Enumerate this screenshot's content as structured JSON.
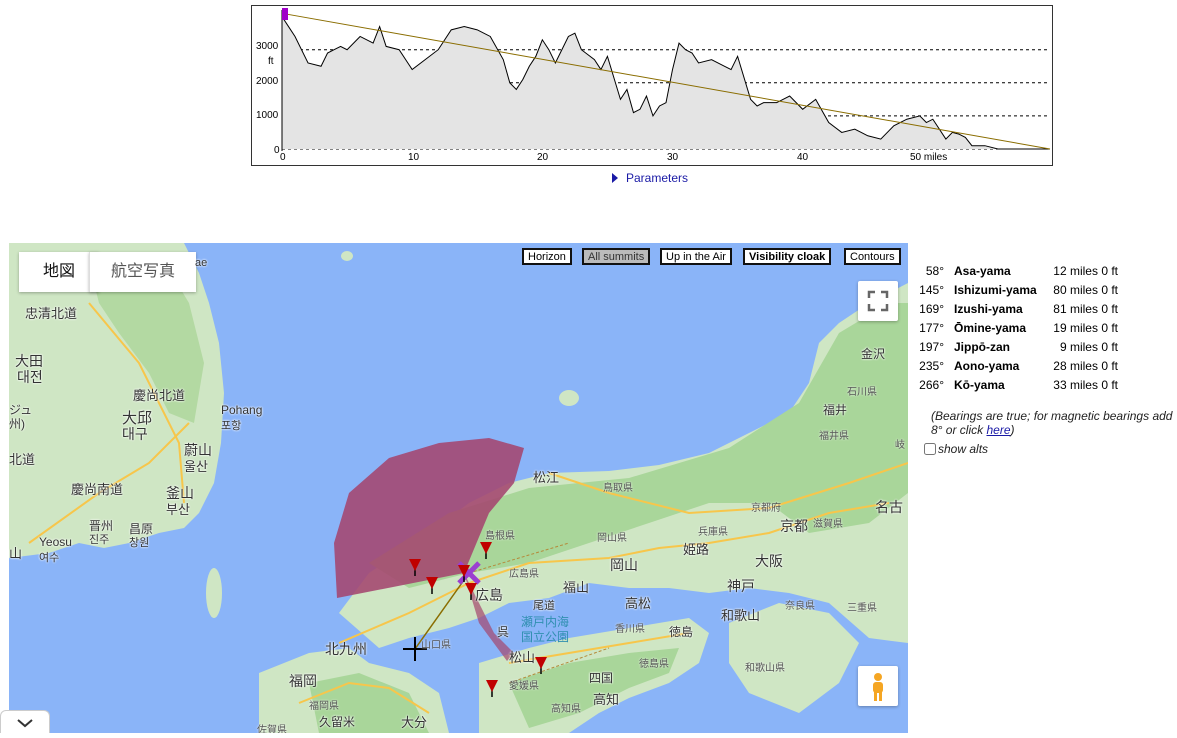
{
  "profile": {
    "y_unit": "ft",
    "y_ticks": [
      "3000",
      "2000",
      "1000",
      "0"
    ],
    "x_ticks": [
      "0",
      "10",
      "20",
      "30",
      "40",
      "50 miles"
    ],
    "colors": {
      "terrain_fill": "#e4e4e4",
      "terrain_line": "#000000",
      "sightline": "#8a6d00",
      "start_marker": "#a000c8"
    }
  },
  "chart_data": {
    "type": "area",
    "title": "",
    "xlabel": "miles",
    "ylabel": "ft",
    "xlim": [
      0,
      59
    ],
    "ylim": [
      0,
      4200
    ],
    "grid": true,
    "series": [
      {
        "values_x": [
          0,
          0.5,
          1,
          2,
          3,
          3.5,
          4,
          4.5,
          5,
          6,
          7,
          7.5,
          8,
          9,
          9.5,
          10,
          11,
          12,
          13,
          14,
          15,
          16,
          17,
          17.5,
          18,
          18.5,
          19,
          19.5,
          20,
          20.5,
          21,
          22,
          22.5,
          23,
          24,
          24.5,
          25,
          26,
          26.5,
          27,
          27.5,
          28,
          28.5,
          29,
          29.5,
          30,
          30.5,
          31,
          31.5,
          32,
          33,
          34,
          34.5,
          35,
          36,
          36.5,
          37,
          38,
          39,
          40,
          41,
          42,
          43,
          44,
          44.5,
          45,
          46,
          47,
          48,
          49,
          49.5,
          50,
          51,
          51.5,
          52,
          52.5,
          53,
          54,
          55,
          56,
          57,
          58,
          59
        ],
        "values_y": [
          4000,
          3700,
          3400,
          2600,
          2500,
          2900,
          3000,
          3100,
          3000,
          3400,
          3200,
          3700,
          3100,
          3000,
          2700,
          2400,
          2700,
          3000,
          3600,
          3700,
          3600,
          3400,
          2700,
          2000,
          1800,
          2100,
          2500,
          2800,
          3300,
          3000,
          2600,
          3400,
          3500,
          3000,
          2700,
          2400,
          2800,
          1500,
          1800,
          1100,
          1200,
          1600,
          1000,
          1300,
          1400,
          2400,
          3200,
          3000,
          2900,
          2600,
          2700,
          2500,
          2400,
          2800,
          1500,
          1300,
          1400,
          1400,
          1600,
          1200,
          1500,
          800,
          500,
          600,
          500,
          400,
          300,
          700,
          900,
          1000,
          800,
          900,
          300,
          500,
          450,
          350,
          100,
          100,
          0,
          0,
          0,
          0,
          0
        ]
      },
      {
        "name": "",
        "values_x": [
          0,
          59
        ],
        "values_y": [
          4100,
          0
        ]
      }
    ]
  },
  "parameters_label": "Parameters",
  "map": {
    "tabs": [
      "地図",
      "航空写真"
    ],
    "toolbar": [
      "Horizon",
      "All summits",
      "Up in the Air",
      "Visibility cloak",
      "Contours"
    ],
    "labels": {
      "chungbuk": "忠清北道",
      "daejeon1": "大田",
      "daejeon2": "대전",
      "gyeongbuk": "慶尚北道",
      "pohang1": "Pohang",
      "pohang2": "포항",
      "daegu1": "大邱",
      "daegu2": "대구",
      "ulsan1": "蔚山",
      "ulsan2": "울산",
      "gyeongnam": "慶尚南道",
      "busan1": "釜山",
      "busan2": "부산",
      "jinju1": "晋州",
      "jinju2": "진주",
      "changwon1": "昌原",
      "changwon2": "창원",
      "yeosu1": "Yeosu",
      "yeosu2": "여수",
      "jeolla": "北道",
      "jeolla2": "ジュ",
      "jeolla3": "州)",
      "jeolla4": "山",
      "top_ae": "ae",
      "matsue": "松江",
      "tottori": "鳥取県",
      "shimane": "島根県",
      "okayama_pref": "岡山県",
      "hyogo": "兵庫県",
      "kyoto_pref": "京都府",
      "shiga": "滋賀県",
      "fukui": "福井県",
      "fukui_city": "福井",
      "ishikawa": "石川県",
      "kanazawa": "金沢",
      "gifu": "岐",
      "nagoya": "名古",
      "kyoto": "京都",
      "okayama": "岡山",
      "himeji": "姫路",
      "osaka": "大阪",
      "kobe": "神戸",
      "fukuyama": "福山",
      "hiroshima_pref": "広島県",
      "hiroshima": "広島",
      "onomichi": "尾道",
      "takamatsu": "高松",
      "kagawa": "香川県",
      "tokushima": "徳島",
      "tokushima_pref": "徳島県",
      "wakayama": "和歌山",
      "wakayama_pref": "和歌山県",
      "nara": "奈良県",
      "mie": "三重県",
      "kure": "呉",
      "inland_sea1": "瀬戸内海",
      "inland_sea2": "国立公園",
      "yamaguchi_pref": "山口県",
      "kitakyushu": "北九州",
      "fukuoka": "福岡",
      "fukuoka_pref": "福岡県",
      "kurume": "久留米",
      "saga": "佐賀県",
      "oita": "大分",
      "matsuyama": "松山",
      "ehime": "愛媛県",
      "shikoku": "四国",
      "kochi": "高知",
      "kochi_pref": "高知県"
    },
    "colors": {
      "sea": "#8ab4f8",
      "land": "#cfe6c4",
      "land_green": "#a9d69a",
      "road": "#f7c64b",
      "cloak": "#a4466e",
      "marker": "#c00000",
      "origin_x": "#9b3fd0"
    }
  },
  "summits": [
    {
      "bearing": "58°",
      "name": "Asa-yama",
      "distance": "12 miles 0 ft"
    },
    {
      "bearing": "145°",
      "name": "Ishizumi-yama",
      "distance": "80 miles 0 ft"
    },
    {
      "bearing": "169°",
      "name": "Izushi-yama",
      "distance": "81 miles 0 ft"
    },
    {
      "bearing": "177°",
      "name": "Ōmine-yama",
      "distance": "19 miles 0 ft"
    },
    {
      "bearing": "197°",
      "name": "Jippō-zan",
      "distance": "9 miles 0 ft"
    },
    {
      "bearing": "235°",
      "name": "Aono-yama",
      "distance": "28 miles 0 ft"
    },
    {
      "bearing": "266°",
      "name": "Kō-yama",
      "distance": "33 miles 0 ft"
    }
  ],
  "note": {
    "text": "(Bearings are true; for magnetic bearings add 8° or click ",
    "link": "here",
    "end": ")"
  },
  "show_alts": "show alts"
}
